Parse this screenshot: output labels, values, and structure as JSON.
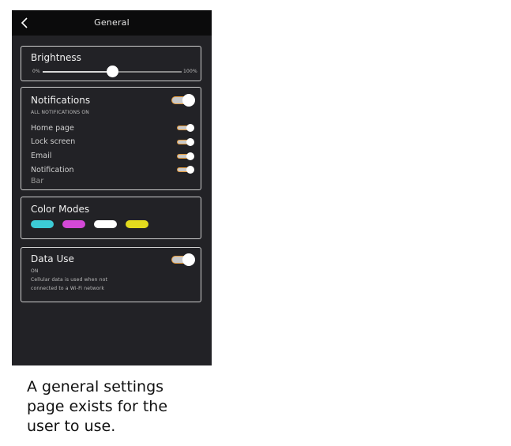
{
  "header": {
    "title": "General",
    "back_icon": "chevron-left-icon"
  },
  "brightness": {
    "title": "Brightness",
    "min_label": "0%",
    "max_label": "100%",
    "value_percent": 50
  },
  "notifications": {
    "title": "Notifications",
    "subtitle": "ALL NOTIFICATIONS ON",
    "master_on": true,
    "items": [
      {
        "label": "Home page",
        "on": true
      },
      {
        "label": "Lock screen",
        "on": true
      },
      {
        "label": "Email",
        "on": true
      },
      {
        "label": "Notification",
        "label2": "Bar",
        "on": true
      }
    ]
  },
  "color_modes": {
    "title": "Color Modes",
    "swatches": [
      "#3ccbd6",
      "#d449d8",
      "#ffffff",
      "#e3db1e"
    ]
  },
  "data_use": {
    "title": "Data Use",
    "status": "ON",
    "description_line1": "Cellular data is used when not",
    "description_line2": "connected to a Wi-Fi network",
    "on": true
  },
  "caption": "A general settings page exists for the user to use.",
  "colors": {
    "toggle_accent": "#e39a3c",
    "background": "#222226",
    "header": "#0b0b0c"
  }
}
